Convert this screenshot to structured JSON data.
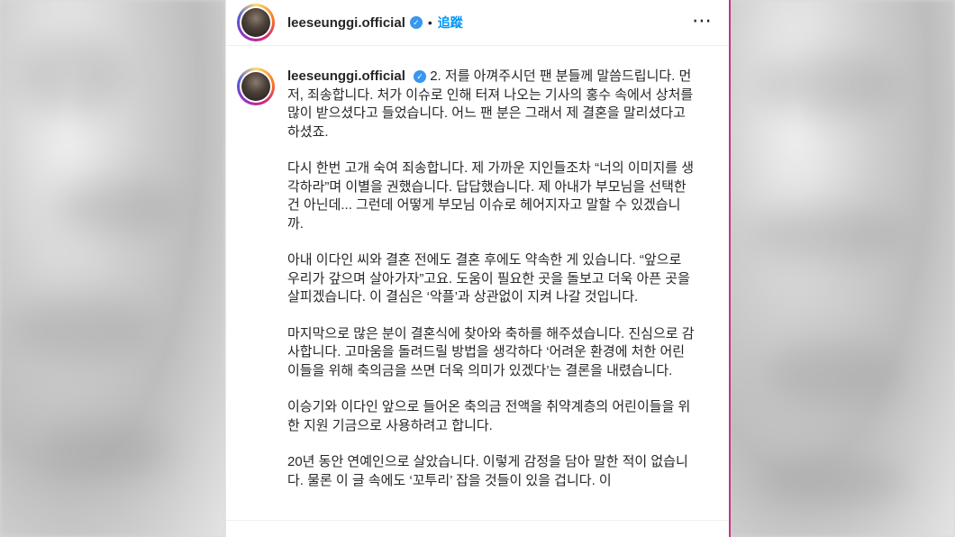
{
  "post": {
    "username": "leeseunggi.official",
    "follow_label": "追蹤",
    "separator": "•",
    "more_icon": "⋯",
    "verified_icon": "✓"
  },
  "caption": {
    "username": "leeseunggi.official",
    "paragraphs": [
      "2. 저를 아껴주시던 팬 분들께 말씀드립니다. 먼저, 죄송합니다. 처가 이슈로 인해 터져 나오는 기사의 홍수 속에서 상처를 많이 받으셨다고 들었습니다. 어느 팬 분은 그래서 제 결혼을 말리셨다고 하셨죠.",
      "다시 한번 고개 숙여 죄송합니다. 제 가까운 지인들조차 “너의 이미지를 생각하라”며 이별을 권했습니다. 답답했습니다. 제 아내가 부모님을 선택한 건 아닌데... 그런데 어떻게 부모님 이슈로 헤어지자고 말할 수 있겠습니까.",
      "아내 이다인 씨와 결혼 전에도 결혼 후에도 약속한 게 있습니다. “앞으로 우리가 갚으며 살아가자”고요. 도움이 필요한 곳을 돌보고 더욱 아픈 곳을 살피겠습니다. 이 결심은 ‘악플’과 상관없이 지켜 나갈 것입니다.",
      "마지막으로 많은 분이 결혼식에 찾아와 축하를 해주셨습니다. 진심으로 감사합니다. 고마움을 돌려드릴 방법을 생각하다 ‘어려운 환경에 처한 어린이들을 위해 축의금을 쓰면 더욱 의미가 있겠다’는 결론을 내렸습니다.",
      "이승기와 이다인 앞으로 들어온 축의금 전액을 취약계층의 어린이들을 위한 지원 기금으로 사용하려고 합니다.",
      "20년 동안 연예인으로 살았습니다. 이렇게 감정을 담아 말한 적이 없습니다. 물론 이 글 속에도 ‘꼬투리’ 잡을 것들이 있을 겁니다. 이"
    ]
  }
}
